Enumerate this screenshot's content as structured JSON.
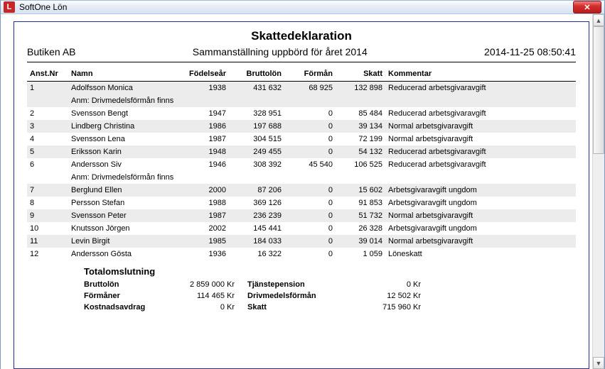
{
  "window": {
    "app_icon_letter": "L",
    "title": "SoftOne Lön",
    "close_btn": "✕"
  },
  "report": {
    "title": "Skattedeklaration",
    "company": "Butiken AB",
    "subtitle": "Sammanställning uppbörd för året 2014",
    "timestamp": "2014-11-25 08:50:41"
  },
  "columns": {
    "nr": "Anst.Nr",
    "name": "Namn",
    "year": "Födelseår",
    "gross": "Bruttolön",
    "benefit": "Förmån",
    "tax": "Skatt",
    "comment": "Kommentar"
  },
  "rows": [
    {
      "nr": "1",
      "name": "Adolfsson Monica",
      "note": "Anm: Drivmedelsförmån finns",
      "year": "1938",
      "gross": "431 632",
      "benefit": "68 925",
      "tax": "132 898",
      "comment": "Reducerad arbetsgivaravgift",
      "alt": true
    },
    {
      "nr": "2",
      "name": "Svensson Bengt",
      "note": "",
      "year": "1947",
      "gross": "328 951",
      "benefit": "0",
      "tax": "85 484",
      "comment": "Reducerad arbetsgivaravgift",
      "alt": false
    },
    {
      "nr": "3",
      "name": "Lindberg Christina",
      "note": "",
      "year": "1986",
      "gross": "197 688",
      "benefit": "0",
      "tax": "39 134",
      "comment": "Normal arbetsgivaravgift",
      "alt": true
    },
    {
      "nr": "4",
      "name": "Svensson Lena",
      "note": "",
      "year": "1987",
      "gross": "304 515",
      "benefit": "0",
      "tax": "72 199",
      "comment": "Normal arbetsgivaravgift",
      "alt": false
    },
    {
      "nr": "5",
      "name": "Eriksson Karin",
      "note": "",
      "year": "1948",
      "gross": "249 455",
      "benefit": "0",
      "tax": "54 132",
      "comment": "Reducerad arbetsgivaravgift",
      "alt": true
    },
    {
      "nr": "6",
      "name": "Andersson Siv",
      "note": "Anm: Drivmedelsförmån finns",
      "year": "1946",
      "gross": "308 392",
      "benefit": "45 540",
      "tax": "106 525",
      "comment": "Reducerad arbetsgivaravgift",
      "alt": false
    },
    {
      "nr": "7",
      "name": "Berglund Ellen",
      "note": "",
      "year": "2000",
      "gross": "87 206",
      "benefit": "0",
      "tax": "15 602",
      "comment": "Arbetsgivaravgift ungdom",
      "alt": true
    },
    {
      "nr": "8",
      "name": "Persson Stefan",
      "note": "",
      "year": "1988",
      "gross": "369 126",
      "benefit": "0",
      "tax": "91 853",
      "comment": "Arbetsgivaravgift ungdom",
      "alt": false
    },
    {
      "nr": "9",
      "name": "Svensson Peter",
      "note": "",
      "year": "1987",
      "gross": "236 239",
      "benefit": "0",
      "tax": "51 732",
      "comment": "Normal arbetsgivaravgift",
      "alt": true
    },
    {
      "nr": "10",
      "name": "Knutsson Jörgen",
      "note": "",
      "year": "2002",
      "gross": "145 441",
      "benefit": "0",
      "tax": "26 328",
      "comment": "Arbetsgivaravgift ungdom",
      "alt": false
    },
    {
      "nr": "11",
      "name": "Levin Birgit",
      "note": "",
      "year": "1985",
      "gross": "184 033",
      "benefit": "0",
      "tax": "39 014",
      "comment": "Normal arbetsgivaravgift",
      "alt": true
    },
    {
      "nr": "12",
      "name": "Andersson Gösta",
      "note": "",
      "year": "1936",
      "gross": "16 322",
      "benefit": "0",
      "tax": "1 059",
      "comment": "Löneskatt",
      "alt": false
    }
  ],
  "totals": {
    "heading": "Totalomslutning",
    "left": [
      {
        "label": "Bruttolön",
        "value": "2 859 000 Kr"
      },
      {
        "label": "Förmåner",
        "value": "114 465 Kr"
      },
      {
        "label": "Kostnadsavdrag",
        "value": "0 Kr"
      }
    ],
    "right": [
      {
        "label": "Tjänstepension",
        "value": "0 Kr"
      },
      {
        "label": "Drivmedelsförmån",
        "value": "12 502 Kr"
      },
      {
        "label": "Skatt",
        "value": "715 960 Kr"
      }
    ]
  }
}
